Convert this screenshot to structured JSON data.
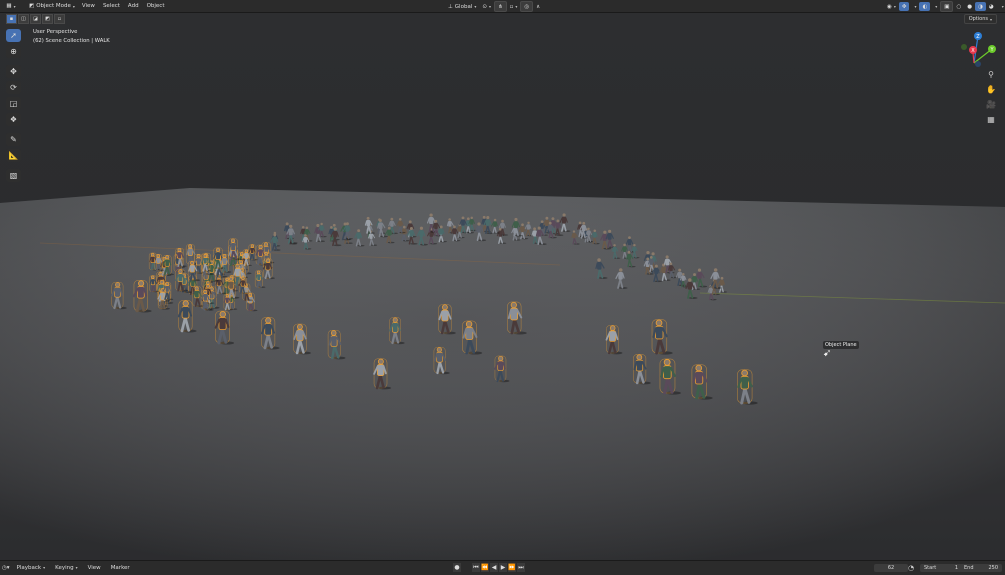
{
  "header": {
    "mode_label": "Object Mode",
    "menus": [
      "View",
      "Select",
      "Add",
      "Object"
    ],
    "transform_orientation": "Global"
  },
  "options_label": "Options",
  "viewport": {
    "view_name": "User Perspective",
    "collection_info": "(62) Scene Collection | WALK",
    "hover_tooltip": "Object Plane"
  },
  "gizmo": {
    "axes": [
      {
        "label": "Z",
        "color": "#2c7ed6"
      },
      {
        "label": "Y",
        "color": "#6ccb2b"
      },
      {
        "label": "X",
        "color": "#e8394e"
      }
    ]
  },
  "timeline": {
    "menus": [
      "Playback",
      "Keying",
      "View",
      "Marker"
    ],
    "current_frame": "62",
    "start_label": "Start",
    "start_value": "1",
    "end_label": "End",
    "end_value": "250"
  },
  "colors": {
    "selection_outline": "#f0a030",
    "active_blue": "#4772b3",
    "ground": "#4a4b4e",
    "background": "#2a2b2d"
  }
}
